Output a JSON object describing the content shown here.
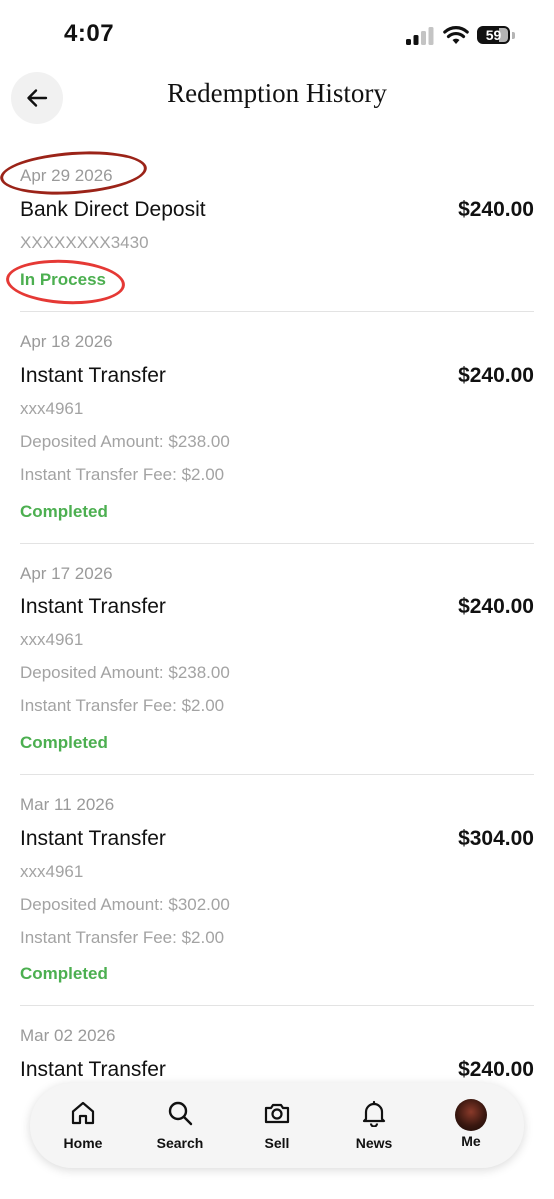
{
  "status_bar": {
    "time": "4:07",
    "battery": "59"
  },
  "header": {
    "title": "Redemption History",
    "back_icon": "arrow-left-icon"
  },
  "transactions": [
    {
      "date": "Apr 29 2026",
      "method": "Bank Direct Deposit",
      "amount": "$240.00",
      "account": "XXXXXXXX3430",
      "status": "In Process"
    },
    {
      "date": "Apr 18 2026",
      "method": "Instant Transfer",
      "amount": "$240.00",
      "account": "xxx4961",
      "deposited": "Deposited Amount: $238.00",
      "fee": "Instant Transfer Fee: $2.00",
      "status": "Completed"
    },
    {
      "date": "Apr 17 2026",
      "method": "Instant Transfer",
      "amount": "$240.00",
      "account": "xxx4961",
      "deposited": "Deposited Amount: $238.00",
      "fee": "Instant Transfer Fee: $2.00",
      "status": "Completed"
    },
    {
      "date": "Mar 11 2026",
      "method": "Instant Transfer",
      "amount": "$304.00",
      "account": "xxx4961",
      "deposited": "Deposited Amount: $302.00",
      "fee": "Instant Transfer Fee: $2.00",
      "status": "Completed"
    },
    {
      "date": "Mar 02 2026",
      "method": "Instant Transfer",
      "amount": "$240.00"
    }
  ],
  "colors": {
    "completed": "#4caf50",
    "annotation_dark": "#9b2318",
    "annotation_bright": "#e53935"
  },
  "nav": {
    "items": [
      {
        "label": "Home",
        "icon": "home-icon"
      },
      {
        "label": "Search",
        "icon": "search-icon"
      },
      {
        "label": "Sell",
        "icon": "camera-icon"
      },
      {
        "label": "News",
        "icon": "bell-icon"
      },
      {
        "label": "Me",
        "icon": "avatar"
      }
    ]
  }
}
